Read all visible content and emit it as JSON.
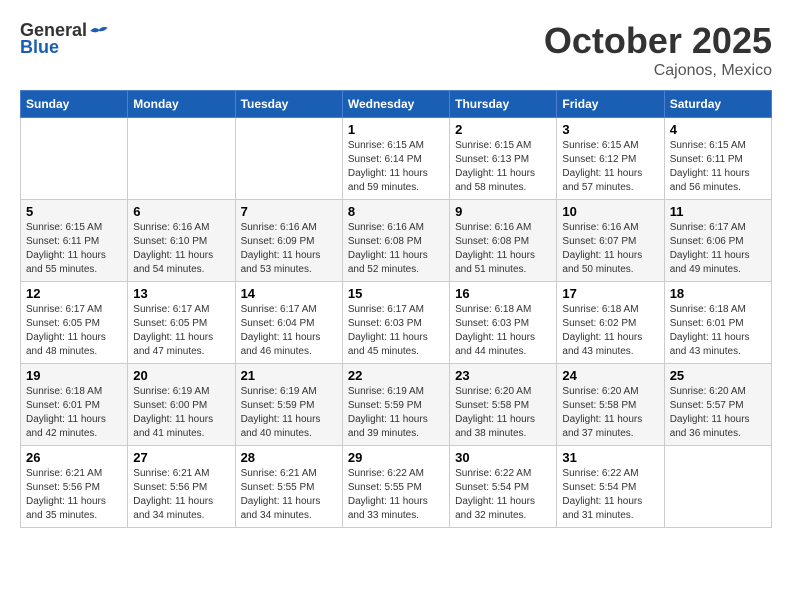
{
  "header": {
    "logo": {
      "general": "General",
      "blue": "Blue"
    },
    "title": "October 2025",
    "subtitle": "Cajonos, Mexico"
  },
  "calendar": {
    "days_of_week": [
      "Sunday",
      "Monday",
      "Tuesday",
      "Wednesday",
      "Thursday",
      "Friday",
      "Saturday"
    ],
    "weeks": [
      [
        {
          "day": "",
          "info": ""
        },
        {
          "day": "",
          "info": ""
        },
        {
          "day": "",
          "info": ""
        },
        {
          "day": "1",
          "sunrise": "6:15 AM",
          "sunset": "6:14 PM",
          "daylight": "11 hours and 59 minutes."
        },
        {
          "day": "2",
          "sunrise": "6:15 AM",
          "sunset": "6:13 PM",
          "daylight": "11 hours and 58 minutes."
        },
        {
          "day": "3",
          "sunrise": "6:15 AM",
          "sunset": "6:12 PM",
          "daylight": "11 hours and 57 minutes."
        },
        {
          "day": "4",
          "sunrise": "6:15 AM",
          "sunset": "6:11 PM",
          "daylight": "11 hours and 56 minutes."
        }
      ],
      [
        {
          "day": "5",
          "sunrise": "6:15 AM",
          "sunset": "6:11 PM",
          "daylight": "11 hours and 55 minutes."
        },
        {
          "day": "6",
          "sunrise": "6:16 AM",
          "sunset": "6:10 PM",
          "daylight": "11 hours and 54 minutes."
        },
        {
          "day": "7",
          "sunrise": "6:16 AM",
          "sunset": "6:09 PM",
          "daylight": "11 hours and 53 minutes."
        },
        {
          "day": "8",
          "sunrise": "6:16 AM",
          "sunset": "6:08 PM",
          "daylight": "11 hours and 52 minutes."
        },
        {
          "day": "9",
          "sunrise": "6:16 AM",
          "sunset": "6:08 PM",
          "daylight": "11 hours and 51 minutes."
        },
        {
          "day": "10",
          "sunrise": "6:16 AM",
          "sunset": "6:07 PM",
          "daylight": "11 hours and 50 minutes."
        },
        {
          "day": "11",
          "sunrise": "6:17 AM",
          "sunset": "6:06 PM",
          "daylight": "11 hours and 49 minutes."
        }
      ],
      [
        {
          "day": "12",
          "sunrise": "6:17 AM",
          "sunset": "6:05 PM",
          "daylight": "11 hours and 48 minutes."
        },
        {
          "day": "13",
          "sunrise": "6:17 AM",
          "sunset": "6:05 PM",
          "daylight": "11 hours and 47 minutes."
        },
        {
          "day": "14",
          "sunrise": "6:17 AM",
          "sunset": "6:04 PM",
          "daylight": "11 hours and 46 minutes."
        },
        {
          "day": "15",
          "sunrise": "6:17 AM",
          "sunset": "6:03 PM",
          "daylight": "11 hours and 45 minutes."
        },
        {
          "day": "16",
          "sunrise": "6:18 AM",
          "sunset": "6:03 PM",
          "daylight": "11 hours and 44 minutes."
        },
        {
          "day": "17",
          "sunrise": "6:18 AM",
          "sunset": "6:02 PM",
          "daylight": "11 hours and 43 minutes."
        },
        {
          "day": "18",
          "sunrise": "6:18 AM",
          "sunset": "6:01 PM",
          "daylight": "11 hours and 43 minutes."
        }
      ],
      [
        {
          "day": "19",
          "sunrise": "6:18 AM",
          "sunset": "6:01 PM",
          "daylight": "11 hours and 42 minutes."
        },
        {
          "day": "20",
          "sunrise": "6:19 AM",
          "sunset": "6:00 PM",
          "daylight": "11 hours and 41 minutes."
        },
        {
          "day": "21",
          "sunrise": "6:19 AM",
          "sunset": "5:59 PM",
          "daylight": "11 hours and 40 minutes."
        },
        {
          "day": "22",
          "sunrise": "6:19 AM",
          "sunset": "5:59 PM",
          "daylight": "11 hours and 39 minutes."
        },
        {
          "day": "23",
          "sunrise": "6:20 AM",
          "sunset": "5:58 PM",
          "daylight": "11 hours and 38 minutes."
        },
        {
          "day": "24",
          "sunrise": "6:20 AM",
          "sunset": "5:58 PM",
          "daylight": "11 hours and 37 minutes."
        },
        {
          "day": "25",
          "sunrise": "6:20 AM",
          "sunset": "5:57 PM",
          "daylight": "11 hours and 36 minutes."
        }
      ],
      [
        {
          "day": "26",
          "sunrise": "6:21 AM",
          "sunset": "5:56 PM",
          "daylight": "11 hours and 35 minutes."
        },
        {
          "day": "27",
          "sunrise": "6:21 AM",
          "sunset": "5:56 PM",
          "daylight": "11 hours and 34 minutes."
        },
        {
          "day": "28",
          "sunrise": "6:21 AM",
          "sunset": "5:55 PM",
          "daylight": "11 hours and 34 minutes."
        },
        {
          "day": "29",
          "sunrise": "6:22 AM",
          "sunset": "5:55 PM",
          "daylight": "11 hours and 33 minutes."
        },
        {
          "day": "30",
          "sunrise": "6:22 AM",
          "sunset": "5:54 PM",
          "daylight": "11 hours and 32 minutes."
        },
        {
          "day": "31",
          "sunrise": "6:22 AM",
          "sunset": "5:54 PM",
          "daylight": "11 hours and 31 minutes."
        },
        {
          "day": "",
          "info": ""
        }
      ]
    ]
  }
}
